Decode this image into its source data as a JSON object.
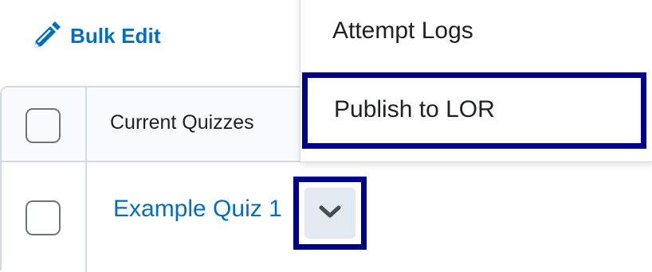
{
  "toolbar": {
    "bulk_edit_label": "Bulk Edit",
    "bulk_edit_icon": "pencil-icon"
  },
  "table": {
    "header": {
      "column_label": "Current Quizzes"
    },
    "rows": [
      {
        "title": "Example Quiz 1"
      }
    ]
  },
  "context_menu": {
    "button_icon": "chevron-down-icon",
    "items": [
      {
        "label": "Attempt Logs"
      },
      {
        "label": "Publish to LOR",
        "focused": true
      }
    ]
  },
  "colors": {
    "link": "#006fbf",
    "focus_ring": "#00008b",
    "border": "#d3d9e3",
    "header_bg": "#f9fbff",
    "button_bg": "#e3e9f1",
    "text": "#202122"
  }
}
